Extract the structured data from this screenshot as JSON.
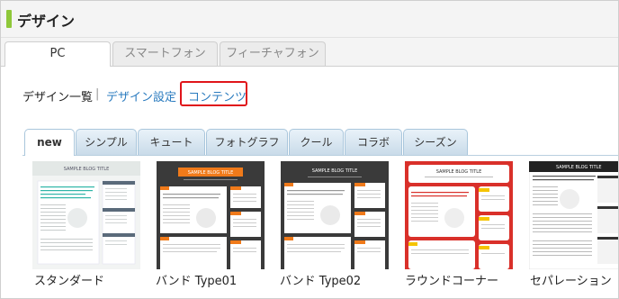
{
  "header": {
    "title": "デザイン"
  },
  "device_tabs": [
    {
      "label": "PC",
      "active": true
    },
    {
      "label": "スマートフォン",
      "active": false
    },
    {
      "label": "フィーチャフォン",
      "active": false
    }
  ],
  "subnav": {
    "current": "デザイン一覧",
    "separator": "|",
    "link1": "デザイン設定",
    "link2": "コンテンツ"
  },
  "category_tabs": [
    {
      "label": "new",
      "active": true
    },
    {
      "label": "シンプル",
      "active": false
    },
    {
      "label": "キュート",
      "active": false
    },
    {
      "label": "フォトグラフ",
      "active": false
    },
    {
      "label": "クール",
      "active": false
    },
    {
      "label": "コラボ",
      "active": false
    },
    {
      "label": "シーズン",
      "active": false
    }
  ],
  "thumbnails": [
    {
      "label": "スタンダード",
      "preview_title": "SAMPLE BLOG TITLE"
    },
    {
      "label": "バンド Type01",
      "preview_title": "SAMPLE BLOG TITLE"
    },
    {
      "label": "バンド Type02",
      "preview_title": "SAMPLE BLOG TITLE"
    },
    {
      "label": "ラウンドコーナー",
      "preview_title": "SAMPLE BLOG TITLE"
    },
    {
      "label": "セパレーション",
      "preview_title": "SAMPLE BLOG TITLE"
    }
  ],
  "colors": {
    "title_accent": "#8fc83a",
    "link": "#2a7bbf",
    "highlight_border": "#e0141a",
    "band_orange": "#f07a1a",
    "round_red": "#d9302a",
    "standard_accent": "#2fb5a8"
  }
}
